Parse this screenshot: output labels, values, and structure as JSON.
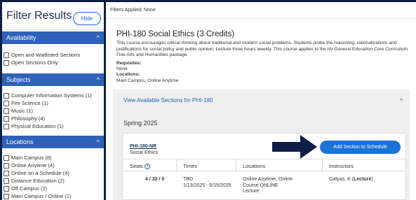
{
  "sidebar": {
    "title": "Filter Results",
    "hide_label": "Hide",
    "sections": [
      {
        "label": "Availability",
        "options": [
          "Open and Waitlisted Sections",
          "Open Sections Only"
        ]
      },
      {
        "label": "Subjects",
        "options": [
          "Computer Information Systems (1)",
          "Fire Science (1)",
          "Music (1)",
          "Philosophy (4)",
          "Physical Education (1)"
        ]
      },
      {
        "label": "Locations",
        "options": [
          "Main Campus (8)",
          "Online Anytime (4)",
          "Online on a Schedule (4)",
          "Distance Education (2)",
          "Off Campus (2)",
          "Main Campus / Online (1)"
        ]
      }
    ]
  },
  "main": {
    "filters_applied": "Filters Applied: None",
    "course_title": "PHI-180 Social Ethics (3 Credits)",
    "course_description": "This course encourages critical thinking about traditional and modern social problems. Students probe the reasoning, rationalizations and justifications for social policy and public opinion. Lecture three hours weekly. This course applies to the IAI General Education Core Curriculum Fine Arts and Humanities package.",
    "requisites_label": "Requisites:",
    "requisites_value": "None",
    "locations_label": "Locations:",
    "locations_value": "Main Campus, Online Anytime",
    "sections_link": "View Available Sections for PHI-180",
    "term": "Spring 2025",
    "section": {
      "code": "PHI-180-NR",
      "name": "Social Ethics",
      "add_label": "Add Section to Schedule",
      "headers": {
        "seats": "Seats",
        "times": "Times",
        "locations": "Locations",
        "instructors": "Instructors"
      },
      "row": {
        "seats": "4 / 32 / 0",
        "times_line1": "TBD",
        "times_line2": "1/13/2025 - 5/15/2025",
        "loc_line1": "Online Anytime, Online",
        "loc_line2": "Course ONLINE",
        "loc_line3": "Lecture",
        "instructor_name": "Gatyas, K (",
        "instructor_role": "Lecture",
        "instructor_close": ")"
      }
    }
  },
  "colors": {
    "navy": "#0e1f47",
    "section_bar": "#2e62b8",
    "accent": "#1a73d9"
  }
}
